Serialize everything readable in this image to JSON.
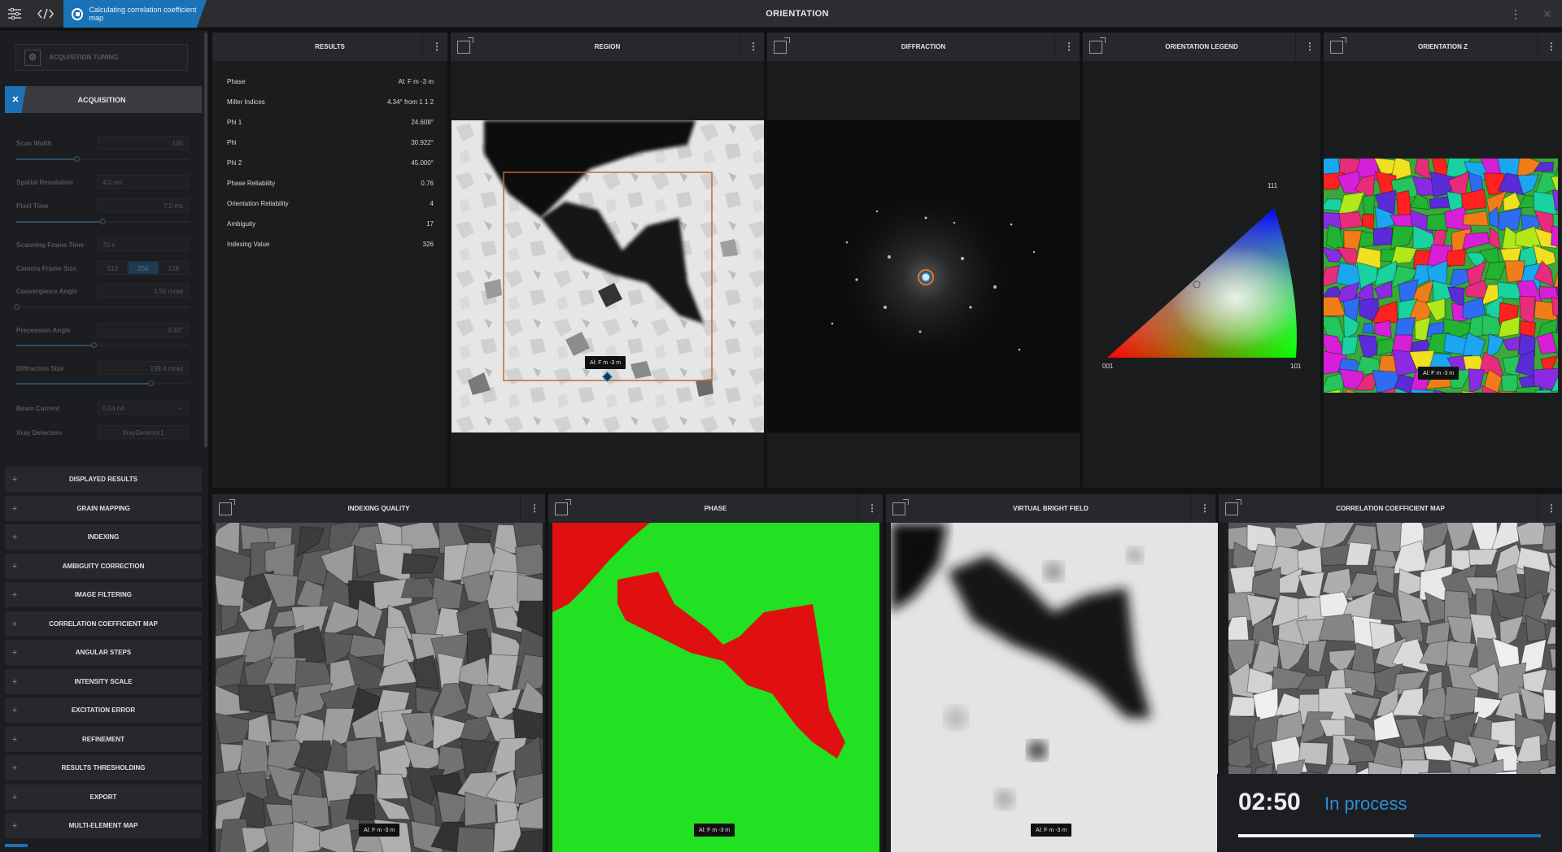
{
  "topbar": {
    "status_label": "Calculating correlation coefficient map",
    "title": "ORIENTATION"
  },
  "sidebar": {
    "tuning_label": "ACQUISITION TUNING",
    "acquisition_label": "ACQUISITION",
    "params": [
      {
        "label": "Scan Width",
        "value": "100"
      },
      {
        "label": "Spatial Resolution",
        "value": "4.0 nm"
      },
      {
        "label": "Pixel Time",
        "value": "7.0 ms"
      },
      {
        "label": "Scanning Frame Time",
        "value": "70 s"
      },
      {
        "label": "Camera Frame Size",
        "options": [
          "512",
          "256",
          "128"
        ],
        "selected": "256"
      },
      {
        "label": "Convergence Angle",
        "value": "1.50 mrad"
      },
      {
        "label": "Precession Angle",
        "value": "0.40°"
      },
      {
        "label": "Diffraction Size",
        "value": "199.4 mrad"
      },
      {
        "label": "Beam Current",
        "value": "0.04 nA"
      },
      {
        "label": "Xray Detectors",
        "value": "XrayDetector1"
      }
    ],
    "sliders": {
      "scan_width": 0.35,
      "pixel_time": 0.5,
      "convergence_angle": 0.0,
      "precession_angle": 0.45,
      "diffraction_size": 0.78
    },
    "sections": [
      "DISPLAYED RESULTS",
      "GRAIN MAPPING",
      "INDEXING",
      "AMBIGUITY CORRECTION",
      "IMAGE FILTERING",
      "CORRELATION COEFFICIENT MAP",
      "ANGULAR STEPS",
      "INTENSITY SCALE",
      "EXCITATION ERROR",
      "REFINEMENT",
      "RESULTS THRESHOLDING",
      "EXPORT",
      "MULTI-ELEMENT MAP"
    ]
  },
  "panels": {
    "results": "RESULTS",
    "region": "REGION",
    "diffraction": "DIFFRACTION",
    "orientation_legend": "ORIENTATION LEGEND",
    "orientation_z": "ORIENTATION Z",
    "indexing_quality": "INDEXING QUALITY",
    "phase": "PHASE",
    "virtual_bright_field": "VIRTUAL BRIGHT FIELD",
    "correlation_coefficient_map": "CORRELATION COEFFICIENT MAP"
  },
  "results": [
    {
      "label": "Phase",
      "value": "Al: F m -3 m"
    },
    {
      "label": "Miller Indices",
      "value": "4.34° from 1 1 2"
    },
    {
      "label": "Phi 1",
      "value": "24.608°"
    },
    {
      "label": "Phi",
      "value": "30.922°"
    },
    {
      "label": "Phi 2",
      "value": "45.000°"
    },
    {
      "label": "Phase Reliability",
      "value": "0.76"
    },
    {
      "label": "Orientation Reliability",
      "value": "4"
    },
    {
      "label": "Ambiguity",
      "value": "17"
    },
    {
      "label": "Indexing Value",
      "value": "326"
    }
  ],
  "phase_tag": "Al: F m -3 m",
  "legend": {
    "top": "111",
    "left": "001",
    "right": "101"
  },
  "timer": {
    "time": "02:50",
    "status": "In process",
    "progress": 0.58
  },
  "colors": {
    "accent": "#1a73b7",
    "phase_green": "#22e022",
    "phase_red": "#e01010"
  }
}
